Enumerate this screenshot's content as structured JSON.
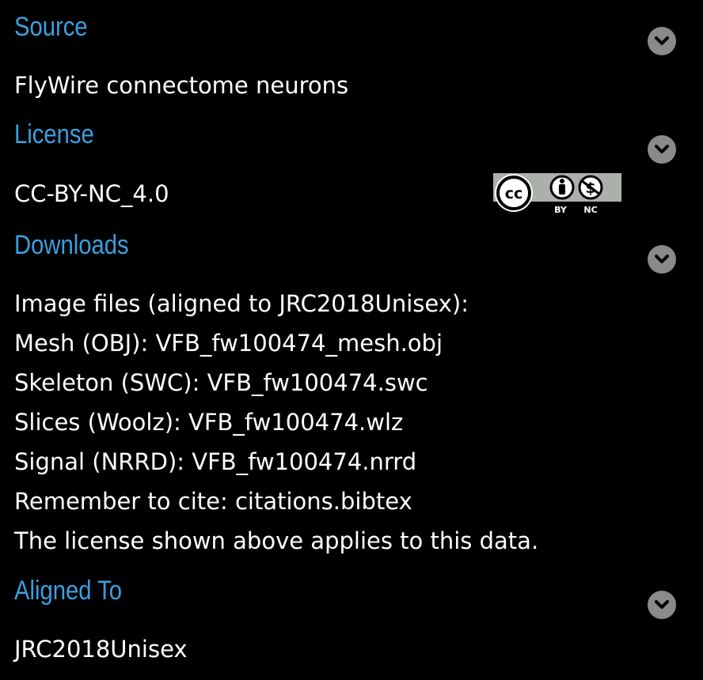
{
  "source": {
    "title": "Source",
    "value": "FlyWire connectome neurons"
  },
  "license": {
    "title": "License",
    "value": "CC-BY-NC_4.0",
    "badge": {
      "cc_text": "cc",
      "by_text": "BY",
      "nc_text": "NC"
    }
  },
  "downloads": {
    "title": "Downloads",
    "heading": "Image files (aligned to JRC2018Unisex):",
    "files": [
      {
        "label": "Mesh (OBJ): ",
        "file": "VFB_fw100474_mesh.obj"
      },
      {
        "label": "Skeleton (SWC): ",
        "file": "VFB_fw100474.swc"
      },
      {
        "label": "Slices (Woolz): ",
        "file": "VFB_fw100474.wlz"
      },
      {
        "label": "Signal (NRRD): ",
        "file": "VFB_fw100474.nrrd"
      }
    ],
    "cite": {
      "label": "Remember to cite: ",
      "file": "citations.bibtex"
    },
    "note": "The license shown above applies to this data."
  },
  "aligned_to": {
    "title": "Aligned To",
    "value": "JRC2018Unisex"
  },
  "colors": {
    "title": "#3aa0e0",
    "background": "#000000",
    "text": "#ffffff",
    "chevron": "#8a8a8a"
  },
  "icons": {
    "collapse": "chevron-down-icon"
  }
}
